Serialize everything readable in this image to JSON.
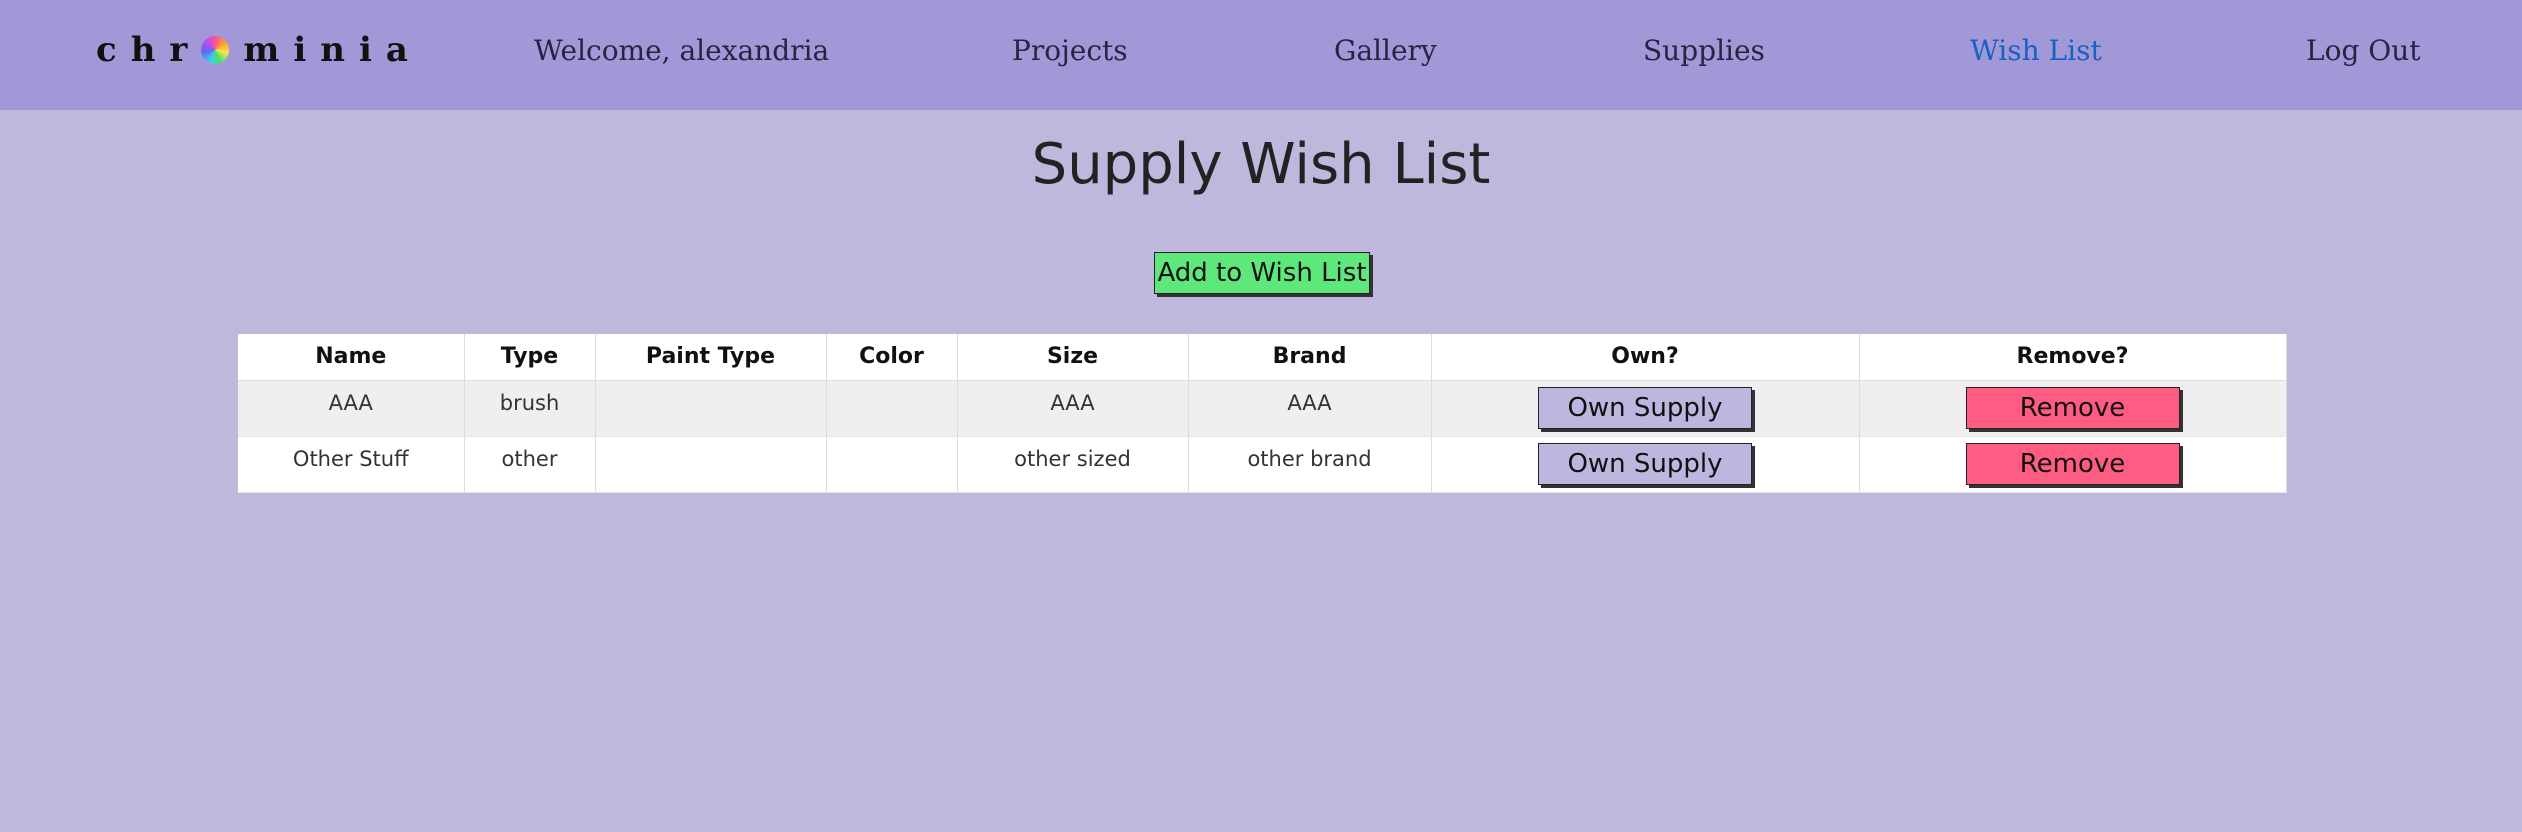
{
  "nav": {
    "logo_text_before": "chr",
    "logo_text_after": "minia",
    "welcome": "Welcome, alexandria",
    "links": {
      "projects": "Projects",
      "gallery": "Gallery",
      "supplies": "Supplies",
      "wish_list": "Wish List",
      "log_out": "Log Out"
    }
  },
  "page": {
    "title": "Supply Wish List",
    "add_button": "Add to Wish List"
  },
  "table": {
    "headers": {
      "name": "Name",
      "type": "Type",
      "paint_type": "Paint Type",
      "color": "Color",
      "size": "Size",
      "brand": "Brand",
      "own": "Own?",
      "remove": "Remove?"
    },
    "rows": [
      {
        "name": "AAA",
        "type": "brush",
        "paint_type": "",
        "color": "",
        "size": "AAA",
        "brand": "AAA",
        "own_label": "Own Supply",
        "remove_label": "Remove"
      },
      {
        "name": "Other Stuff",
        "type": "other",
        "paint_type": "",
        "color": "",
        "size": "other sized",
        "brand": "other brand",
        "own_label": "Own Supply",
        "remove_label": "Remove"
      }
    ]
  },
  "colors": {
    "navbar": "#a198d8",
    "background": "#c0b7dd",
    "active_link": "#1a5fc2",
    "add_button": "#5ee87c",
    "own_button": "#bfb6e0",
    "remove_button": "#ff5c84"
  }
}
